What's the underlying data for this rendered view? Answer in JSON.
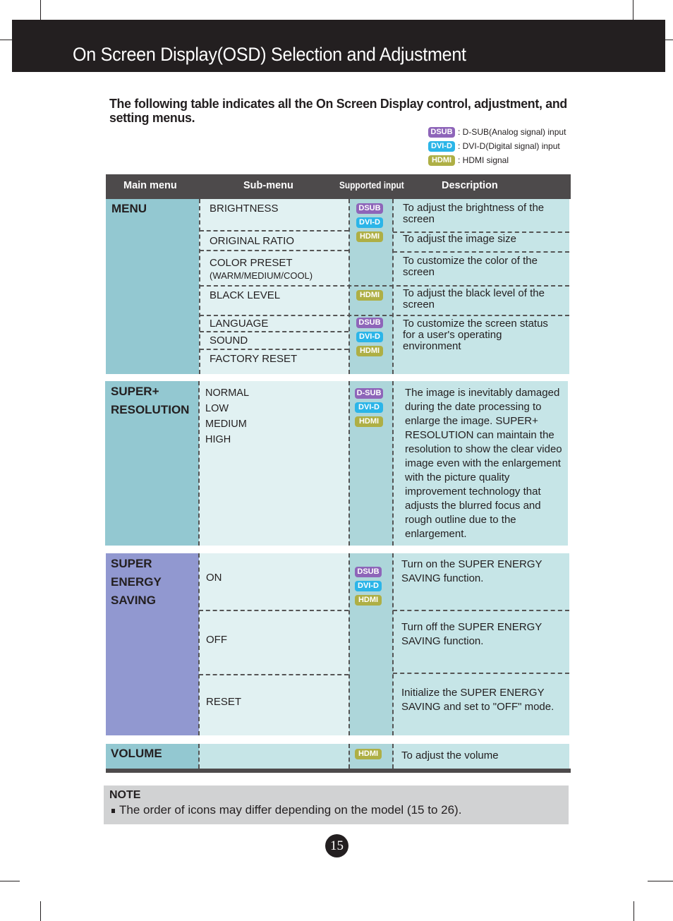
{
  "header": {
    "title": "On Screen Display(OSD) Selection and Adjustment"
  },
  "intro": "The following table indicates all the On Screen Display control, adjustment, and setting menus.",
  "legend": [
    {
      "badge": "DSUB",
      "text": ": D-SUB(Analog signal) input",
      "color": "#8e65b9"
    },
    {
      "badge": "DVI-D",
      "text": ": DVI-D(Digital signal) input",
      "color": "#2bb5e8"
    },
    {
      "badge": "HDMI",
      "text": ": HDMI signal",
      "color": "#aeaf45"
    }
  ],
  "table": {
    "headers": {
      "main": "Main menu",
      "sub": "Sub-menu",
      "input": "Supported input",
      "desc": "Description"
    },
    "menu": {
      "main": "MENU",
      "rows": [
        {
          "sub": "BRIGHTNESS",
          "desc": "To adjust the brightness of the screen"
        },
        {
          "sub": "ORIGINAL RATIO",
          "desc": "To adjust the image size"
        },
        {
          "sub": "COLOR PRESET",
          "sub_note": "(WARM/MEDIUM/COOL)",
          "desc": "To customize the color of the screen"
        },
        {
          "sub": "BLACK LEVEL",
          "desc": "To adjust the black level of the screen"
        },
        {
          "sub": "LANGUAGE"
        },
        {
          "sub": "SOUND"
        },
        {
          "sub": "FACTORY RESET"
        }
      ],
      "group_desc": "To customize the screen status for a user's operating environment",
      "badges_a": [
        "DSUB",
        "DVI-D",
        "HDMI"
      ],
      "badges_b": [
        "HDMI"
      ],
      "badges_c": [
        "DSUB",
        "DVI-D",
        "HDMI"
      ]
    },
    "super_resolution": {
      "main_line1": "SUPER+",
      "main_line2": "RESOLUTION",
      "options": [
        "NORMAL",
        "LOW",
        "MEDIUM",
        "HIGH"
      ],
      "badges": [
        "D-SUB",
        "DVI-D",
        "HDMI"
      ],
      "desc": "The image is inevitably damaged during the date processing to enlarge the image. SUPER+ RESOLUTION can maintain the resolution to show the clear video image even with the enlargement with the picture quality improvement technology that adjusts the blurred focus and rough outline due to the enlargement."
    },
    "super_energy": {
      "main_line1": "SUPER",
      "main_line2": "ENERGY",
      "main_line3": "SAVING",
      "badges": [
        "DSUB",
        "DVI-D",
        "HDMI"
      ],
      "rows": [
        {
          "sub": "ON",
          "desc": "Turn on the SUPER ENERGY SAVING function."
        },
        {
          "sub": "OFF",
          "desc": "Turn off the SUPER ENERGY SAVING function."
        },
        {
          "sub": "RESET",
          "desc": "Initialize the SUPER ENERGY SAVING and set to \"OFF\" mode."
        }
      ]
    },
    "volume": {
      "main": "VOLUME",
      "badges": [
        "HDMI"
      ],
      "desc": "To adjust the volume"
    }
  },
  "note": {
    "title": "NOTE",
    "text": "The order of icons may differ depending on the model (15 to 26)."
  },
  "page_number": "15"
}
